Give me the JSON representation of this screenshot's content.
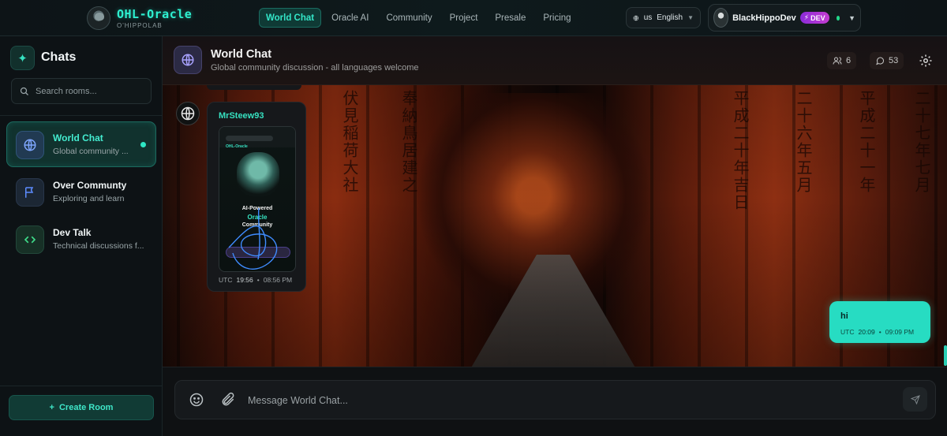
{
  "brand": {
    "title": "OHL-Oracle",
    "subtitle": "O'HIPPOLAB"
  },
  "nav": [
    {
      "label": "World Chat",
      "active": true
    },
    {
      "label": "Oracle AI"
    },
    {
      "label": "Community"
    },
    {
      "label": "Project"
    },
    {
      "label": "Presale"
    },
    {
      "label": "Pricing"
    }
  ],
  "language": {
    "code": "us",
    "label": "English"
  },
  "user": {
    "name": "BlackHippoDev",
    "badge": "DEV",
    "status": "online"
  },
  "sidebar": {
    "title": "Chats",
    "search_placeholder": "Search rooms...",
    "rooms": [
      {
        "name": "World Chat",
        "desc": "Global community ...",
        "icon": "globe-icon",
        "active": true,
        "unread": true
      },
      {
        "name": "Over Communty",
        "desc": "Exploring and learn",
        "icon": "flag-icon"
      },
      {
        "name": "Dev Talk",
        "desc": "Technical discussions f...",
        "icon": "code-icon"
      }
    ],
    "create_label": "Create Room"
  },
  "header": {
    "title": "World Chat",
    "subtitle": "Global community discussion - all languages welcome",
    "members": "6",
    "messages": "53"
  },
  "messages": [
    {
      "author": "MrSteew93",
      "type": "image",
      "image_text": {
        "brand": "OHL-Oracle",
        "line1": "AI-Powered",
        "line2": "Oracle",
        "line3": "Community"
      },
      "utc_label": "UTC",
      "utc_time": "19:56",
      "local_time": "08:56 PM"
    },
    {
      "author": "BlackHippoDev",
      "own": true,
      "text": "hi",
      "utc_label": "UTC",
      "utc_time": "20:09",
      "local_time": "09:09 PM"
    }
  ],
  "composer": {
    "placeholder": "Message World Chat..."
  },
  "colors": {
    "accent": "#2ee6c4",
    "own_bubble": "#27dcc2",
    "dev_badge": "#b034d4"
  }
}
